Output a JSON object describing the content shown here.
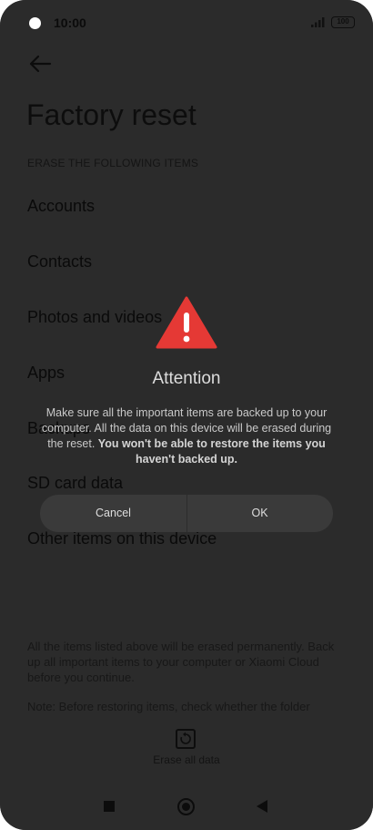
{
  "status_bar": {
    "time": "10:00",
    "battery": "100"
  },
  "page": {
    "title": "Factory reset",
    "section_header": "ERASE THE FOLLOWING ITEMS",
    "items": [
      "Accounts",
      "Contacts",
      "Photos and videos",
      "Apps",
      "Backups",
      "SD card data",
      "Other items on this device"
    ],
    "footer_note_1": "All the items listed above will be erased permanently. Back up all important items to your computer or Xiaomi Cloud before you continue.",
    "footer_note_2": "Note: Before restoring items, check whether the folder",
    "erase_button_label": "Erase all data"
  },
  "dialog": {
    "title": "Attention",
    "body_normal": "Make sure all the important items are backed up to your computer. All the data on this device will be erased during the reset. ",
    "body_bold": "You won't be able to restore the items you haven't backed up.",
    "cancel_label": "Cancel",
    "ok_label": "OK"
  },
  "colors": {
    "dim_background": "#2b2b2b",
    "warning_red": "#e53935",
    "button_bar": "#3a3a3a"
  }
}
